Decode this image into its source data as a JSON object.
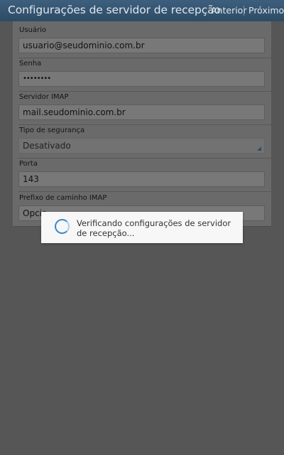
{
  "header": {
    "title": "Configurações de servidor de recepção",
    "prev_label": "Anterior",
    "next_label": "Próximo"
  },
  "form": {
    "username": {
      "label": "Usuário",
      "value": "usuario@seudominio.com.br"
    },
    "password": {
      "label": "Senha",
      "value": "••••••••"
    },
    "server": {
      "label": "Servidor IMAP",
      "value": "mail.seudominio.com.br"
    },
    "security": {
      "label": "Tipo de segurança",
      "value": "Desativado"
    },
    "port": {
      "label": "Porta",
      "value": "143"
    },
    "prefix": {
      "label": "Prefixo de caminho IMAP",
      "value": "Opcio"
    }
  },
  "dialog": {
    "message": "Verificando configurações de servidor de recepção..."
  },
  "colors": {
    "accent": "#3c87c8",
    "actionbar": "#2d4b66"
  }
}
